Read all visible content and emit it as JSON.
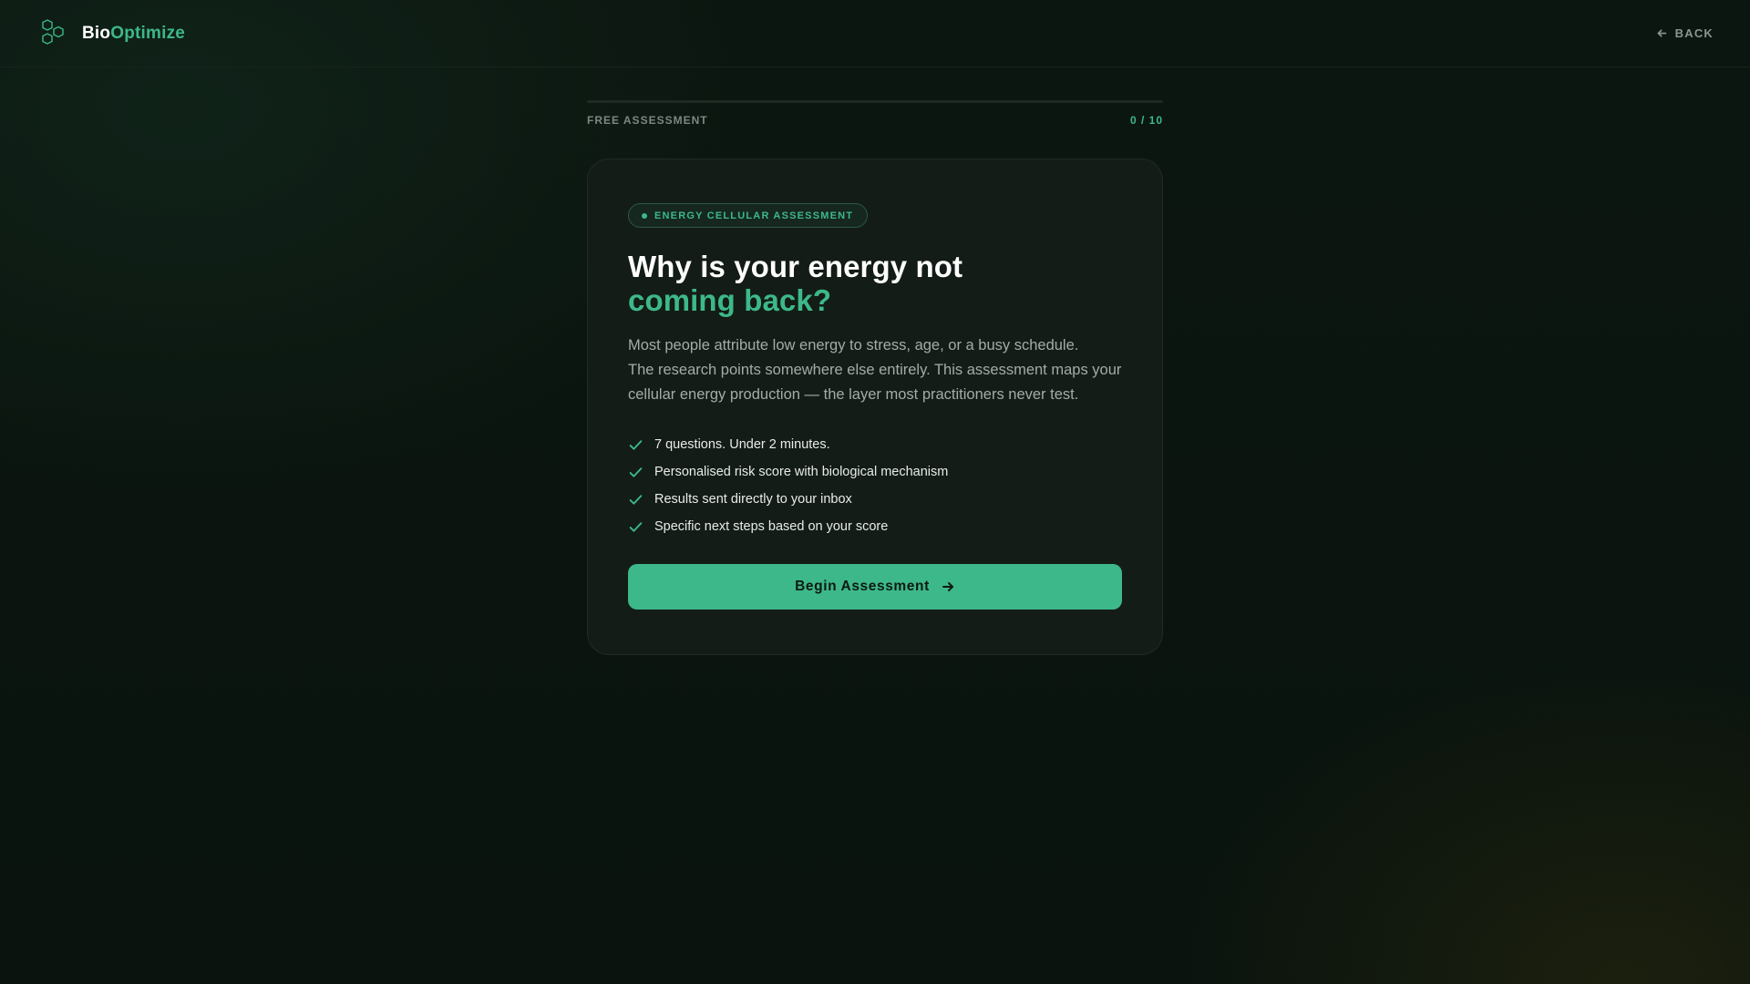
{
  "header": {
    "brand_part1": "Bio",
    "brand_part2": "Optimize",
    "logo_icon": "hexagon-cluster-icon",
    "back_label": "BACK",
    "back_icon": "arrow-left-icon"
  },
  "progress": {
    "label": "FREE ASSESSMENT",
    "count": "0 / 10",
    "fraction": 0
  },
  "card": {
    "badge": "ENERGY CELLULAR ASSESSMENT",
    "headline_line1": "Why is your energy not",
    "headline_line2": "coming back?",
    "description_lines": [
      "Most people attribute low energy to stress, age, or a busy schedule.",
      "The research points somewhere else entirely. This assessment maps your",
      "cellular energy production — the layer most practitioners never test."
    ],
    "checklist": [
      "7 questions. Under 2 minutes.",
      "Personalised risk score with biological mechanism",
      "Results sent directly to your inbox",
      "Specific next steps based on your score"
    ],
    "check_icon": "checkmark-icon",
    "cta_label": "Begin Assessment",
    "cta_icon": "arrow-right-icon"
  },
  "colors": {
    "accent": "#3db88a",
    "background": "#0b150f",
    "card": "#131c16"
  }
}
